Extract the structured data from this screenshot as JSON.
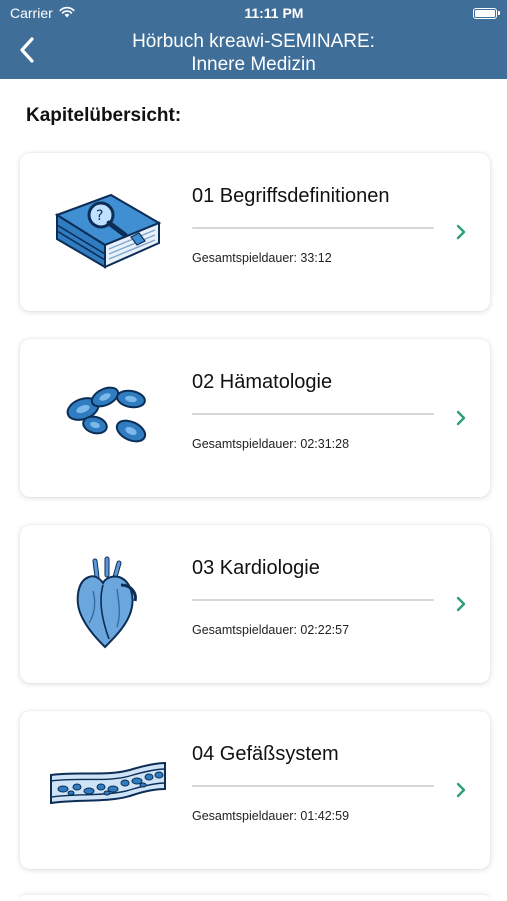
{
  "status_bar": {
    "carrier": "Carrier",
    "time": "11:11 PM",
    "icons": [
      "wifi-icon",
      "battery-icon"
    ]
  },
  "nav": {
    "title_line1": "Hörbuch kreawi-SEMINARE:",
    "title_line2": "Innere Medizin",
    "back_icon": "chevron-left-icon",
    "bar_color": "#3f6e98"
  },
  "section_title": "Kapitelübersicht:",
  "accent_color": "#2f9e7c",
  "chapters": [
    {
      "title": "01 Begriffsdefinitionen",
      "duration_label": "Gesamtspieldauer: 33:12",
      "illustration": "book-magnifier-illustration"
    },
    {
      "title": "02 Hämatologie",
      "duration_label": "Gesamtspieldauer: 02:31:28",
      "illustration": "blood-cells-illustration"
    },
    {
      "title": "03 Kardiologie",
      "duration_label": "Gesamtspieldauer: 02:22:57",
      "illustration": "heart-illustration"
    },
    {
      "title": "04 Gefäßsystem",
      "duration_label": "Gesamtspieldauer: 01:42:59",
      "illustration": "blood-vessel-illustration"
    }
  ]
}
